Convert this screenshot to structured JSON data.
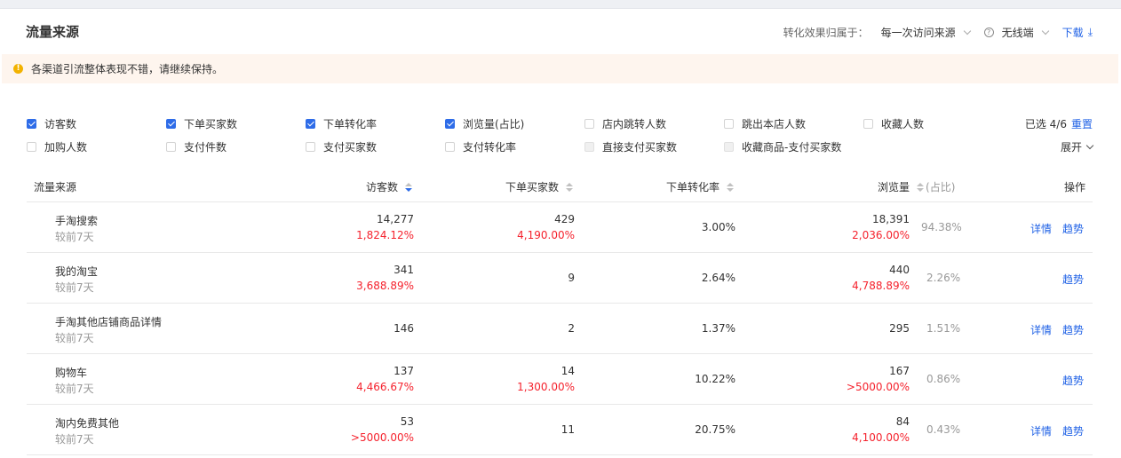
{
  "header": {
    "title": "流量来源",
    "attribution_label": "转化效果归属于：",
    "attribution_value": "每一次访问来源",
    "device_value": "无线端",
    "download_label": "下载"
  },
  "alert": {
    "text": "各渠道引流整体表现不错，请继续保持。"
  },
  "filters": {
    "row1": [
      {
        "label": "访客数",
        "checked": true
      },
      {
        "label": "下单买家数",
        "checked": true
      },
      {
        "label": "下单转化率",
        "checked": true
      },
      {
        "label": "浏览量(占比)",
        "checked": true
      },
      {
        "label": "店内跳转人数",
        "checked": false
      },
      {
        "label": "跳出本店人数",
        "checked": false
      },
      {
        "label": "收藏人数",
        "checked": false
      }
    ],
    "row2": [
      {
        "label": "加购人数",
        "checked": false
      },
      {
        "label": "支付件数",
        "checked": false
      },
      {
        "label": "支付买家数",
        "checked": false
      },
      {
        "label": "支付转化率",
        "checked": false
      },
      {
        "label": "直接支付买家数",
        "checked": false,
        "disabled": true
      },
      {
        "label": "收藏商品-支付买家数",
        "checked": false,
        "disabled": true
      }
    ],
    "selected_count": "已选 4/6",
    "reset_label": "重置",
    "expand_label": "展开"
  },
  "table": {
    "headers": {
      "source": "流量来源",
      "visitors": "访客数",
      "buyers": "下单买家数",
      "conversion": "下单转化率",
      "pageviews": "浏览量",
      "share": "(占比)",
      "actions": "操作"
    },
    "rows": [
      {
        "source": "手淘搜索",
        "compare": "较前7天",
        "visitors": "14,277",
        "visitors_change": "1,824.12%",
        "buyers": "429",
        "buyers_change": "4,190.00%",
        "conversion": "3.00%",
        "pageviews": "18,391",
        "pageviews_change": "2,036.00%",
        "share": "94.38%",
        "detail": "详情",
        "trend": "趋势"
      },
      {
        "source": "我的淘宝",
        "compare": "较前7天",
        "visitors": "341",
        "visitors_change": "3,688.89%",
        "buyers": "9",
        "buyers_change": "",
        "conversion": "2.64%",
        "pageviews": "440",
        "pageviews_change": "4,788.89%",
        "share": "2.26%",
        "detail": "",
        "trend": "趋势"
      },
      {
        "source": "手淘其他店铺商品详情",
        "compare": "较前7天",
        "visitors": "146",
        "visitors_change": "",
        "buyers": "2",
        "buyers_change": "",
        "conversion": "1.37%",
        "pageviews": "295",
        "pageviews_change": "",
        "share": "1.51%",
        "detail": "详情",
        "trend": "趋势"
      },
      {
        "source": "购物车",
        "compare": "较前7天",
        "visitors": "137",
        "visitors_change": "4,466.67%",
        "buyers": "14",
        "buyers_change": "1,300.00%",
        "conversion": "10.22%",
        "pageviews": "167",
        "pageviews_change": ">5000.00%",
        "share": "0.86%",
        "detail": "",
        "trend": "趋势"
      },
      {
        "source": "淘内免费其他",
        "compare": "较前7天",
        "visitors": "53",
        "visitors_change": ">5000.00%",
        "buyers": "11",
        "buyers_change": "",
        "conversion": "20.75%",
        "pageviews": "84",
        "pageviews_change": "4,100.00%",
        "share": "0.43%",
        "detail": "详情",
        "trend": "趋势"
      }
    ]
  }
}
